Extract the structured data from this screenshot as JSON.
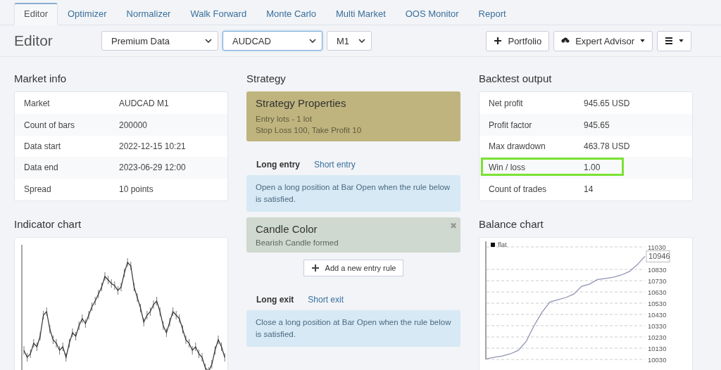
{
  "tabs": [
    {
      "label": "Editor",
      "selected": true
    },
    {
      "label": "Optimizer",
      "selected": false
    },
    {
      "label": "Normalizer",
      "selected": false
    },
    {
      "label": "Walk Forward",
      "selected": false
    },
    {
      "label": "Monte Carlo",
      "selected": false
    },
    {
      "label": "Multi Market",
      "selected": false
    },
    {
      "label": "OOS Monitor",
      "selected": false
    },
    {
      "label": "Report",
      "selected": false
    }
  ],
  "toolbar": {
    "title": "Editor",
    "selects": [
      {
        "value": "Premium Data",
        "focused": false
      },
      {
        "value": "AUDCAD",
        "focused": true
      },
      {
        "value": "M1",
        "focused": false
      }
    ],
    "buttons": [
      {
        "kind": "plus",
        "label": "Portfolio",
        "caret": false
      },
      {
        "kind": "cloud",
        "label": "Expert Advisor",
        "caret": true
      },
      {
        "kind": "menu",
        "caret": true
      }
    ]
  },
  "market_info": {
    "title": "Market info",
    "rows": [
      {
        "label": "Market",
        "value": "AUDCAD M1"
      },
      {
        "label": "Count of bars",
        "value": "200000"
      },
      {
        "label": "Data start",
        "value": "2022-12-15 10:21"
      },
      {
        "label": "Data end",
        "value": "2023-06-29 12:00"
      },
      {
        "label": "Spread",
        "value": "10 points"
      }
    ]
  },
  "indicator_chart": {
    "title": "Indicator chart"
  },
  "strategy": {
    "title": "Strategy",
    "properties": {
      "title": "Strategy Properties",
      "lines": [
        "Entry lots - 1 lot",
        "Stop Loss 100, Take Profit 10"
      ]
    },
    "entry_tabs": [
      {
        "label": "Long entry",
        "selected": true
      },
      {
        "label": "Short entry",
        "selected": false
      }
    ],
    "entry_info": "Open a long position at Bar Open when the rule below is satisfied.",
    "rules": [
      {
        "title": "Candle Color",
        "description": "Bearish Candle formed",
        "close": "✖"
      }
    ],
    "add_button": "Add a new entry rule",
    "exit_tabs": [
      {
        "label": "Long exit",
        "selected": true
      },
      {
        "label": "Short exit",
        "selected": false
      }
    ],
    "exit_info": "Close a long position at Bar Open when the rule below is satisfied."
  },
  "backtest": {
    "title": "Backtest output",
    "rows": [
      {
        "label": "Net profit",
        "value": "945.65 USD",
        "highlighted": false
      },
      {
        "label": "Profit factor",
        "value": "945.65",
        "highlighted": false
      },
      {
        "label": "Max drawdown",
        "value": "463.78 USD",
        "highlighted": false
      },
      {
        "label": "Win / loss",
        "value": "1.00",
        "highlighted": true
      },
      {
        "label": "Count of trades",
        "value": "14",
        "highlighted": false
      }
    ]
  },
  "balance_chart": {
    "title": "Balance chart",
    "chart_data": {
      "type": "line",
      "ylim": [
        10030,
        11030
      ],
      "grid": true,
      "yticks": [
        10030,
        10130,
        10230,
        10330,
        10430,
        10530,
        10630,
        10730,
        10830,
        {
          "value": 10946,
          "label": "10946"
        },
        11030
      ],
      "series": [
        {
          "name": "flat",
          "color": "#8f93b5",
          "values": [
            10035,
            10050,
            10060,
            10080,
            10110,
            10190,
            10330,
            10450,
            10540,
            10560,
            10580,
            10610,
            10680,
            10700,
            10740,
            10750,
            10760,
            10780,
            10810,
            10870,
            10946
          ]
        }
      ]
    }
  }
}
